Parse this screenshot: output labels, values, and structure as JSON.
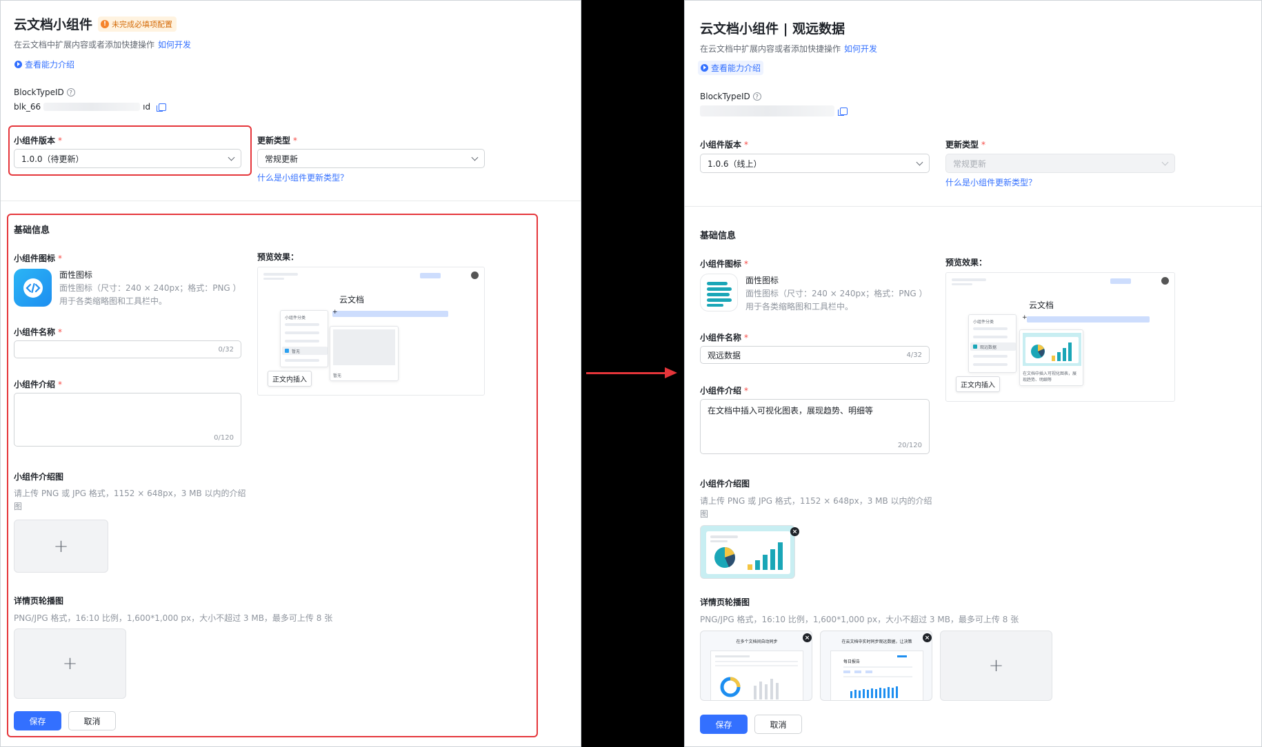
{
  "left": {
    "title": "云文档小组件",
    "badge": "未完成必填项配置",
    "subtitle": "在云文档中扩展内容或者添加快捷操作",
    "dev_link": "如何开发",
    "intro_link": "查看能力介绍",
    "block_label": "BlockTypeID",
    "block_prefix": "blk_66",
    "block_suffix": "ıd",
    "version_label": "小组件版本",
    "version_value": "1.0.0（待更新）",
    "update_label": "更新类型",
    "update_value": "常规更新",
    "update_help": "什么是小组件更新类型？",
    "section_title": "基础信息",
    "icon_label": "小组件图标",
    "icon_title": "面性图标",
    "icon_desc1": "面性图标（尺寸：240 × 240px；格式：PNG ）",
    "icon_desc2": "用于各类缩略图和工具栏中。",
    "preview_label": "预览效果：",
    "preview_doc": "云文档",
    "preview_tag": "正文内插入",
    "preview_item": "暂无",
    "preview_menu": "小组件分类",
    "name_label": "小组件名称",
    "name_value": "",
    "name_counter": "0/32",
    "intro_label": "小组件介绍",
    "intro_value": "",
    "intro_counter": "0/120",
    "img_label": "小组件介绍图",
    "img_desc1": "请上传 PNG 或 JPG 格式，1152 × 648px，3 MB 以内的介绍",
    "img_desc2": "图",
    "carousel_label": "详情页轮播图",
    "carousel_desc": "PNG/JPG 格式，16:10 比例，1,600*1,000 px，大小不超过 3 MB，最多可上传 8 张",
    "plus": "+",
    "save": "保存",
    "cancel": "取消"
  },
  "right": {
    "title": "云文档小组件 | 观远数据",
    "subtitle": "在云文档中扩展内容或者添加快捷操作",
    "dev_link": "如何开发",
    "intro_link": "查看能力介绍",
    "block_label": "BlockTypeID",
    "version_label": "小组件版本",
    "version_value": "1.0.6（线上）",
    "update_label": "更新类型",
    "update_value": "常规更新",
    "update_help": "什么是小组件更新类型？",
    "section_title": "基础信息",
    "icon_label": "小组件图标",
    "icon_title": "面性图标",
    "icon_desc1": "面性图标（尺寸：240 × 240px；格式：PNG ）",
    "icon_desc2": "用于各类缩略图和工具栏中。",
    "preview_label": "预览效果：",
    "preview_doc": "云文档",
    "preview_tag": "正文内插入",
    "preview_item": "观远数据",
    "preview_menu": "小组件分类",
    "preview_card1": "在文档中插入可视化图表，展",
    "preview_card2": "现趋势、明细等",
    "name_label": "小组件名称",
    "name_value": "观远数据",
    "name_counter": "4/32",
    "intro_label": "小组件介绍",
    "intro_value": "在文档中插入可视化图表，展现趋势、明细等",
    "intro_counter": "20/120",
    "img_label": "小组件介绍图",
    "img_desc1": "请上传 PNG 或 JPG 格式，1152 × 648px，3 MB 以内的介绍",
    "img_desc2": "图",
    "carousel_label": "详情页轮播图",
    "carousel_desc": "PNG/JPG 格式，16:10 比例，1,600*1,000 px，大小不超过 3 MB，最多可上传 8 张",
    "thumb1_title": "在多个文档间自动同步",
    "thumb2_title": "在云文档中实时同步观远数据，让决策",
    "thumb2_sub": "每日报告",
    "plus": "+",
    "close": "×",
    "save": "保存",
    "cancel": "取消"
  },
  "colors": {
    "accent": "#3370ff",
    "highlight": "#e5353a",
    "warning": "#d46b08",
    "teal": "#1aa6b7"
  },
  "icons": [
    "warning-icon",
    "play-icon",
    "help-icon",
    "copy-icon",
    "chevron-down-icon",
    "code-widget-icon",
    "text-lines-icon",
    "close-icon",
    "plus-icon",
    "arrow-right-icon"
  ]
}
